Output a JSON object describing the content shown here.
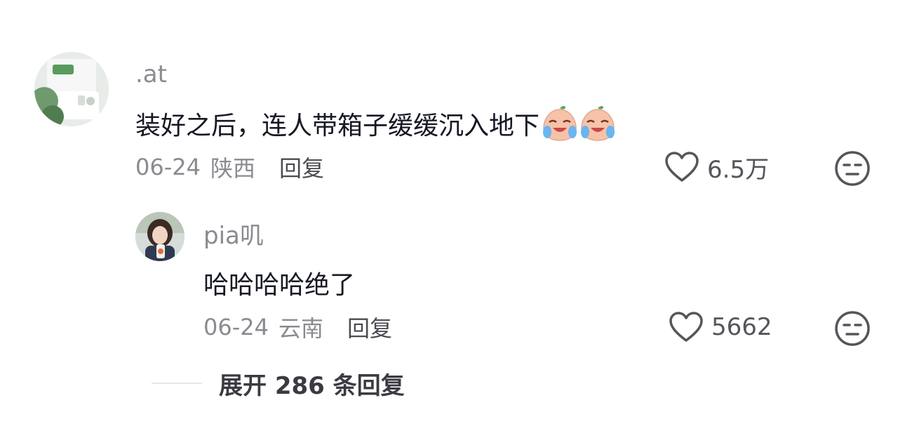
{
  "comments": [
    {
      "username": ".at",
      "text": "装好之后，连人带箱子缓缓沉入地下",
      "emoji": [
        "crying-laughing-emoji",
        "crying-laughing-emoji"
      ],
      "date": "06-24",
      "location": "陕西",
      "reply_label": "回复",
      "likes": "6.5万",
      "icons": {
        "like": "heart-outline-icon",
        "dislike": "unamused-face-icon"
      }
    },
    {
      "username": "pia叽",
      "text": "哈哈哈哈绝了",
      "date": "06-24",
      "location": "云南",
      "reply_label": "回复",
      "likes": "5662",
      "icons": {
        "like": "heart-outline-icon",
        "dislike": "unamused-face-icon"
      }
    }
  ],
  "expand_replies": "展开 286 条回复",
  "colors": {
    "muted": "#8a8b91",
    "text": "#161823",
    "reply": "#4a4b52",
    "icon": "#55565c"
  }
}
